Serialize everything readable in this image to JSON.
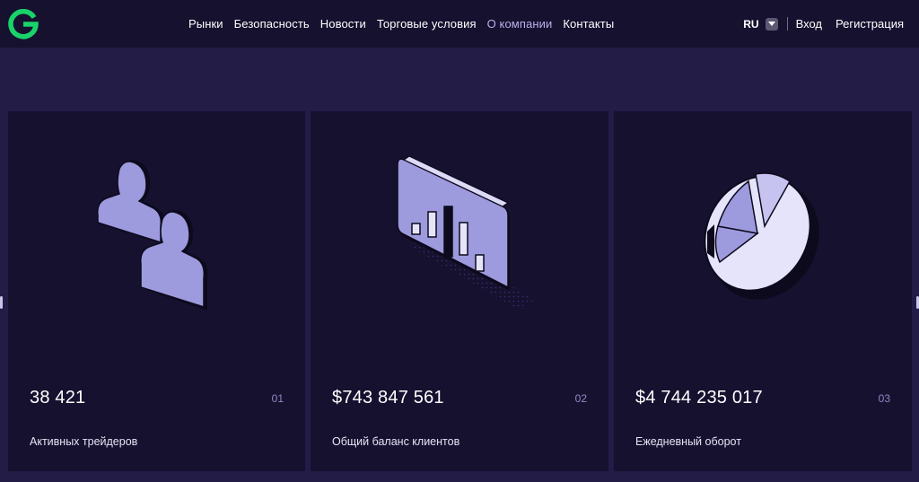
{
  "header": {
    "logo_icon": "g-logo-icon",
    "nav": [
      {
        "label": "Рынки",
        "active": false
      },
      {
        "label": "Безопасность",
        "active": false
      },
      {
        "label": "Новости",
        "active": false
      },
      {
        "label": "Торговые условия",
        "active": false
      },
      {
        "label": "О компании",
        "active": true
      },
      {
        "label": "Контакты",
        "active": false
      }
    ],
    "language": "RU",
    "login_label": "Вход",
    "register_label": "Регистрация"
  },
  "stats": [
    {
      "value": "38 421",
      "number": "01",
      "label": "Активных трейдеров",
      "icon": "users-icon"
    },
    {
      "value": "$743 847 561",
      "number": "02",
      "label": "Общий баланс клиентов",
      "icon": "bar-chart-card-icon"
    },
    {
      "value": "$4 744 235 017",
      "number": "03",
      "label": "Ежедневный оборот",
      "icon": "pie-chart-icon"
    }
  ],
  "colors": {
    "background": "#221c47",
    "header": "#16112f",
    "card": "#16112f",
    "brand_green": "#19d36a",
    "accent_lilac": "#9d9ade",
    "active_nav": "#b7b3ea"
  }
}
